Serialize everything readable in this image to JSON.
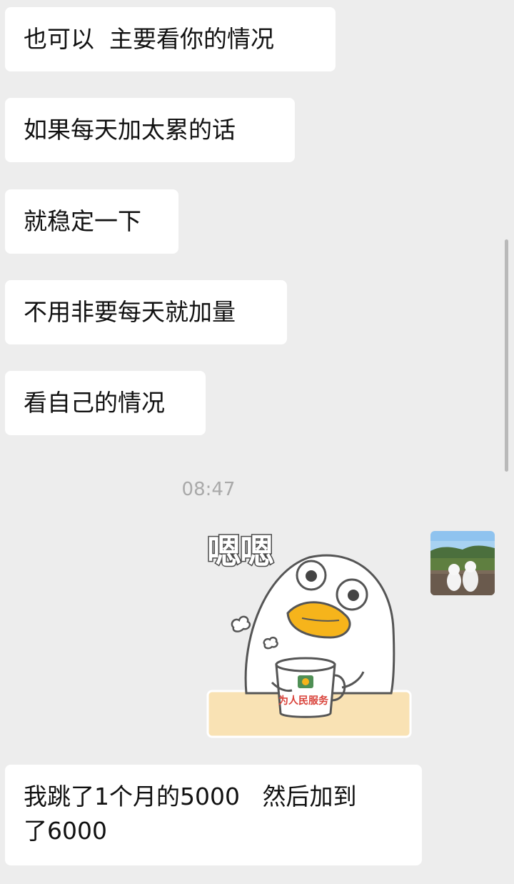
{
  "messages": [
    {
      "text": "也可以  主要看你的情况"
    },
    {
      "text": "如果每天加太累的话"
    },
    {
      "text": "就稳定一下"
    },
    {
      "text": "不用非要每天就加量"
    },
    {
      "text": "看自己的情况"
    }
  ],
  "timestamp": "08:47",
  "sticker": {
    "caption": "嗯嗯",
    "mug_text": "为人民服务",
    "icon": "duck-with-mug-sticker"
  },
  "outgoing_avatar_icon": "landscape-with-two-dogs-avatar",
  "last_message": {
    "text": "我跳了1个月的5000   然后加到\n了6000"
  },
  "colors": {
    "background": "#ededed",
    "bubble": "#ffffff",
    "text": "#111111",
    "timestamp": "#a9a9a9",
    "duck_beak": "#f6b41b",
    "table": "#f9e2b4"
  }
}
